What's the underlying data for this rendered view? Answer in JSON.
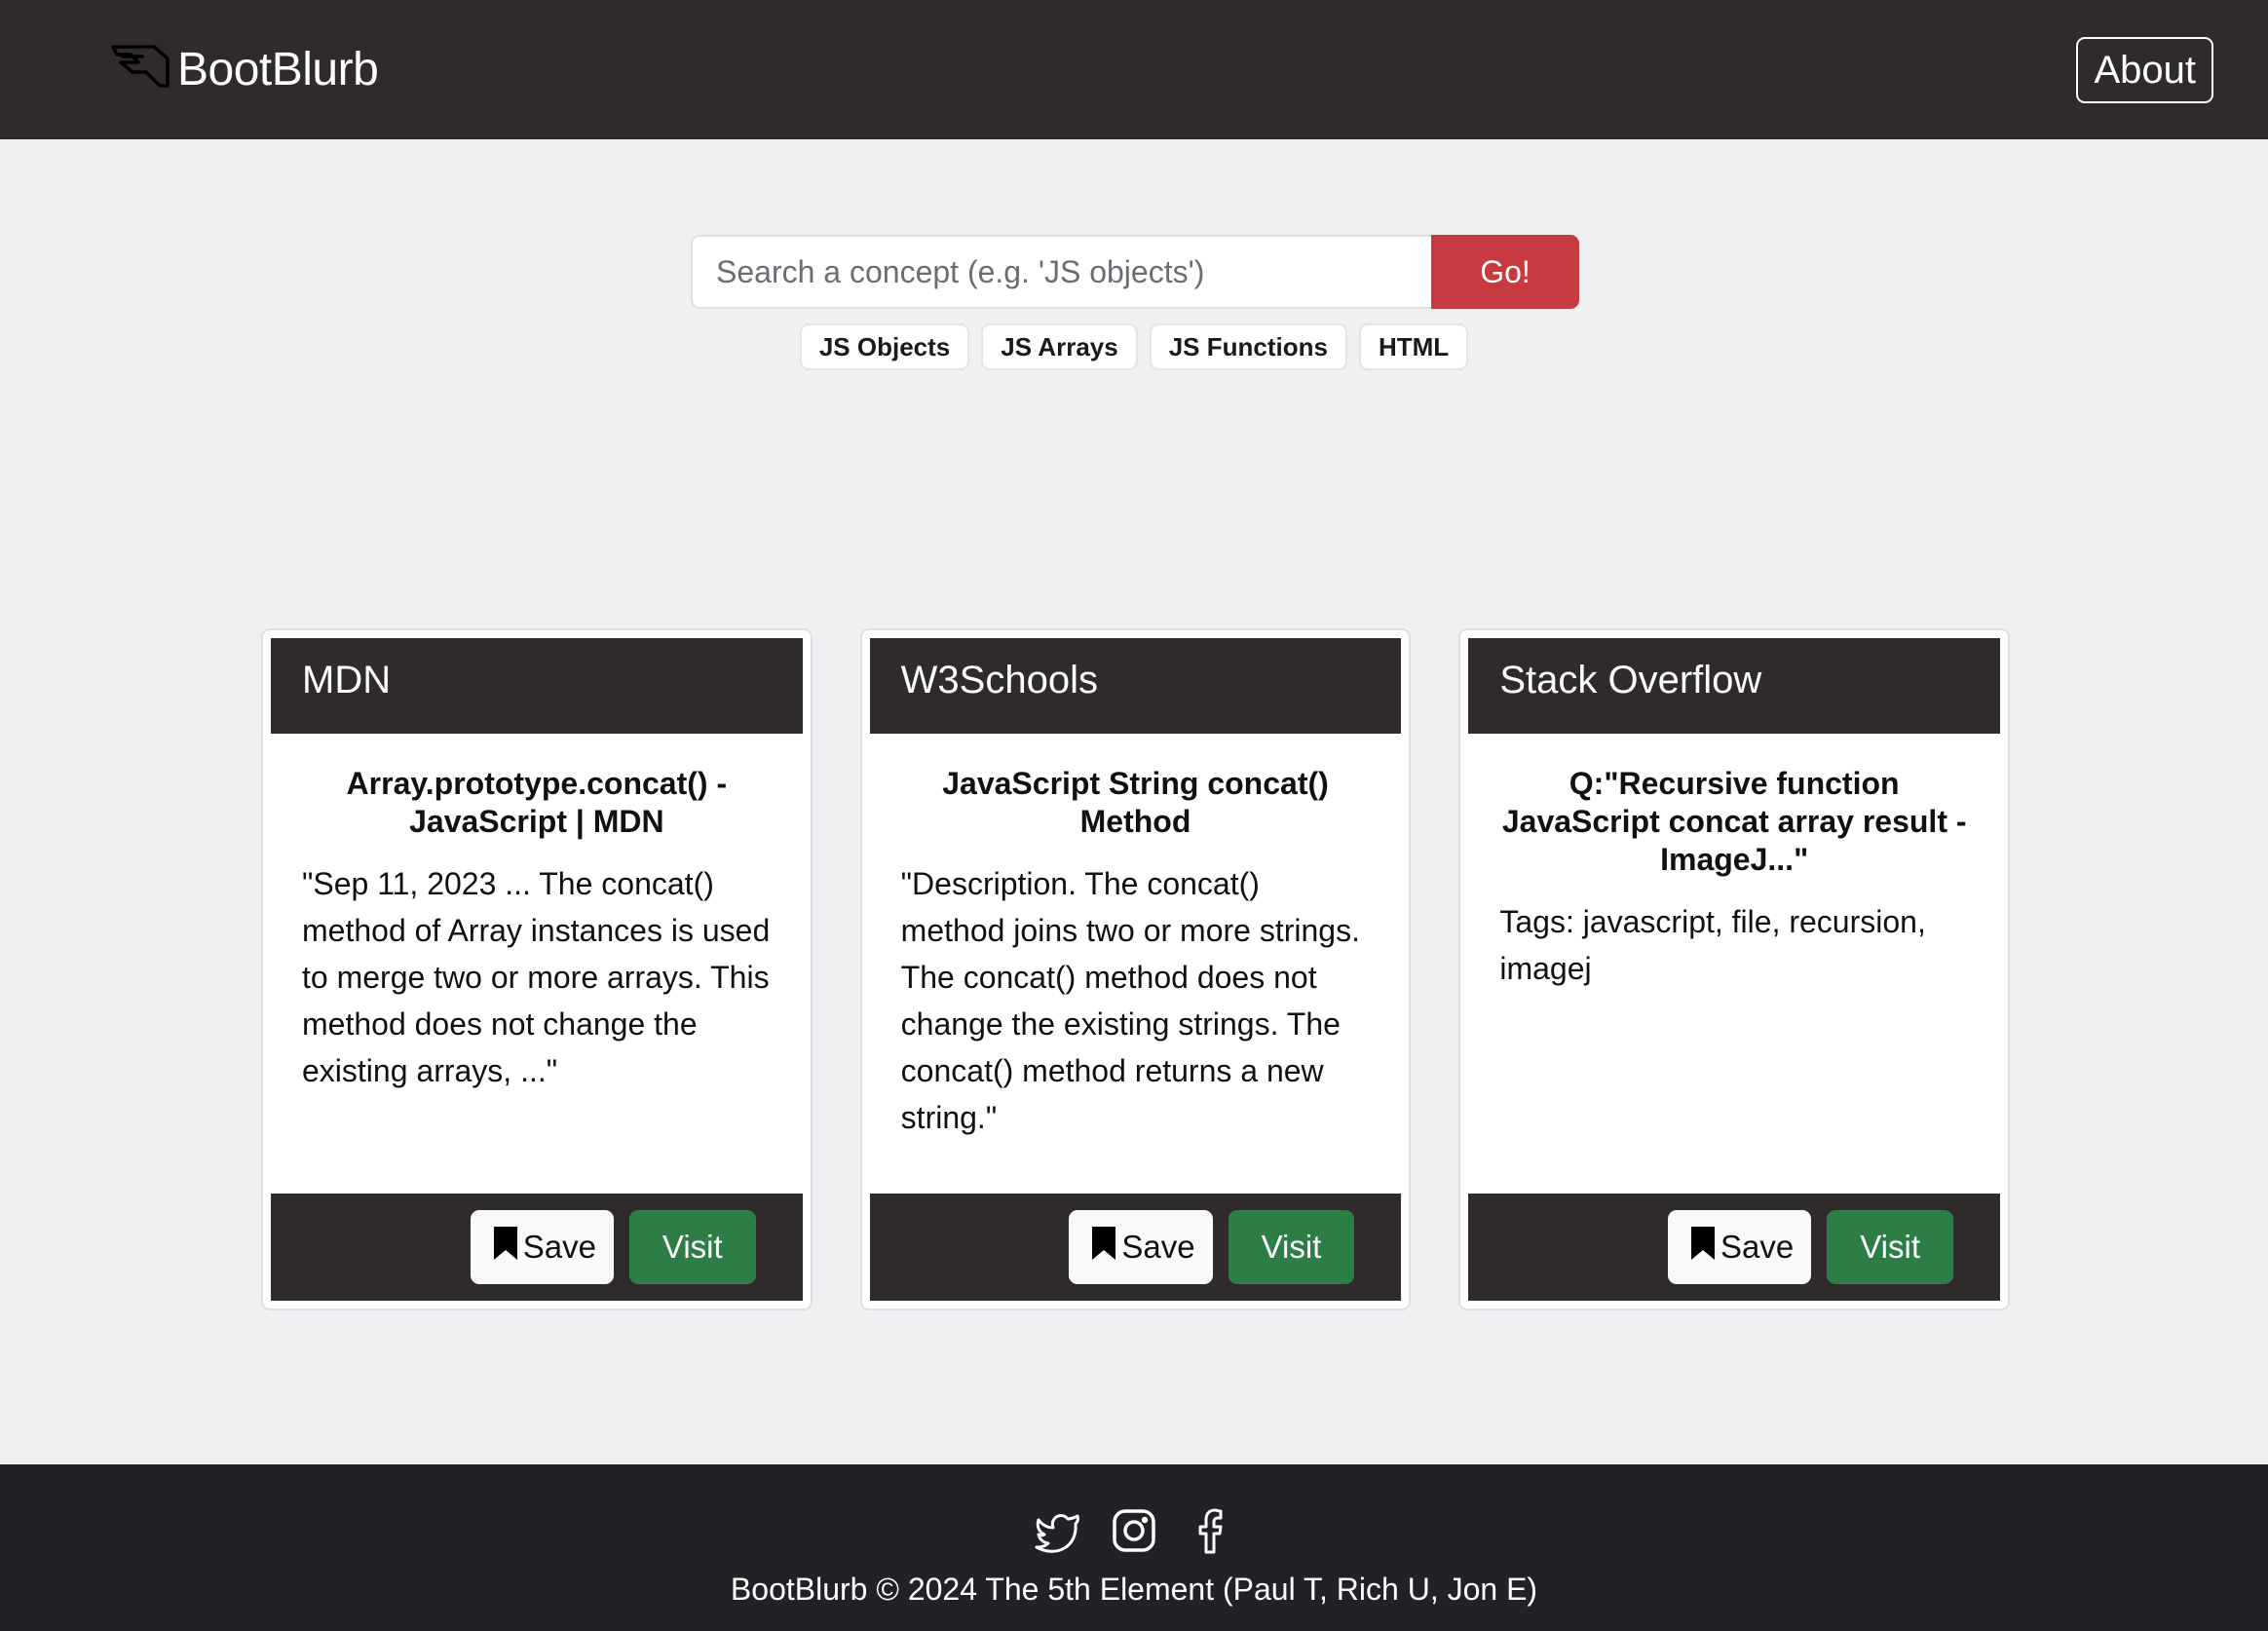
{
  "navbar": {
    "brand": "BootBlurb",
    "brand_icon": "winged-logo-icon",
    "about_label": "About"
  },
  "search": {
    "placeholder": "Search a concept (e.g. 'JS objects')",
    "value": "",
    "button_label": "Go!"
  },
  "quick_tags": [
    "JS Objects",
    "JS Arrays",
    "JS Functions",
    "HTML"
  ],
  "cards": [
    {
      "source": "MDN",
      "title": "Array.prototype.concat() - JavaScript | MDN",
      "text": "\"Sep 11, 2023 ... The concat() method of Array instances is used to merge two or more arrays. This method does not change the existing arrays, ...\"",
      "save_label": "Save",
      "visit_label": "Visit"
    },
    {
      "source": "W3Schools",
      "title": "JavaScript String concat() Method",
      "text": "\"Description. The concat() method joins two or more strings. The concat() method does not change the existing strings. The concat() method returns a new string.\"",
      "save_label": "Save",
      "visit_label": "Visit"
    },
    {
      "source": "Stack Overflow",
      "title": "Q:\"Recursive function JavaScript concat array result - ImageJ...\"",
      "text": "Tags: javascript, file, recursion, imagej",
      "save_label": "Save",
      "visit_label": "Visit"
    }
  ],
  "footer": {
    "social_icons": [
      "twitter-icon",
      "instagram-icon",
      "facebook-icon"
    ],
    "copyright": "BootBlurb © 2024 The 5th Element (Paul T, Rich U, Jon E)"
  },
  "colors": {
    "navbar_bg": "#2f2b2b",
    "page_bg": "#eff0f2",
    "go_button": "#c63a40",
    "visit_button": "#2d7d46",
    "footer_bg": "#212226"
  }
}
